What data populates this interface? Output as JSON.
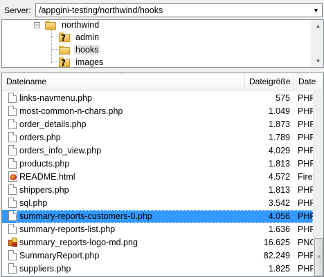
{
  "pathbar": {
    "label": "Server:",
    "path": "/appgini-testing/northwind/hooks",
    "dropdown_icon": "chevron-down-icon"
  },
  "tree": {
    "items": [
      {
        "label": "northwind",
        "icon": "folder-icon",
        "expander": "−"
      },
      {
        "label": "admin",
        "icon": "folder-unknown-icon"
      },
      {
        "label": "hooks",
        "icon": "folder-icon",
        "selected": true
      },
      {
        "label": "images",
        "icon": "folder-unknown-icon"
      }
    ]
  },
  "list": {
    "columns": [
      "Dateiname",
      "Dateigröße",
      "Date"
    ],
    "sort_indicator": "^",
    "rows": [
      {
        "name": "links-navmenu.php",
        "size": "575",
        "type": "PHP",
        "icon": "file-icon"
      },
      {
        "name": "most-common-n-chars.php",
        "size": "1.049",
        "type": "PHP",
        "icon": "file-icon"
      },
      {
        "name": "order_details.php",
        "size": "1.873",
        "type": "PHP",
        "icon": "file-icon"
      },
      {
        "name": "orders.php",
        "size": "1.789",
        "type": "PHP",
        "icon": "file-icon"
      },
      {
        "name": "orders_info_view.php",
        "size": "4.029",
        "type": "PHP",
        "icon": "file-icon"
      },
      {
        "name": "products.php",
        "size": "1.813",
        "type": "PHP",
        "icon": "file-icon"
      },
      {
        "name": "README.html",
        "size": "4.572",
        "type": "Firef",
        "icon": "html-file-icon"
      },
      {
        "name": "shippers.php",
        "size": "1.813",
        "type": "PHP",
        "icon": "file-icon"
      },
      {
        "name": "sql.php",
        "size": "3.542",
        "type": "PHP",
        "icon": "file-icon"
      },
      {
        "name": "summary-reports-customers-0.php",
        "size": "4.056",
        "type": "PHP",
        "icon": "file-icon",
        "selected": true
      },
      {
        "name": "summary-reports-list.php",
        "size": "1.636",
        "type": "PHP",
        "icon": "file-icon"
      },
      {
        "name": "summary_reports-logo-md.png",
        "size": "16.625",
        "type": "PNG",
        "icon": "image-file-icon"
      },
      {
        "name": "SummaryReport.php",
        "size": "82.249",
        "type": "PHP",
        "icon": "file-icon"
      },
      {
        "name": "suppliers.php",
        "size": "1.825",
        "type": "PHP",
        "icon": "file-icon"
      }
    ]
  }
}
